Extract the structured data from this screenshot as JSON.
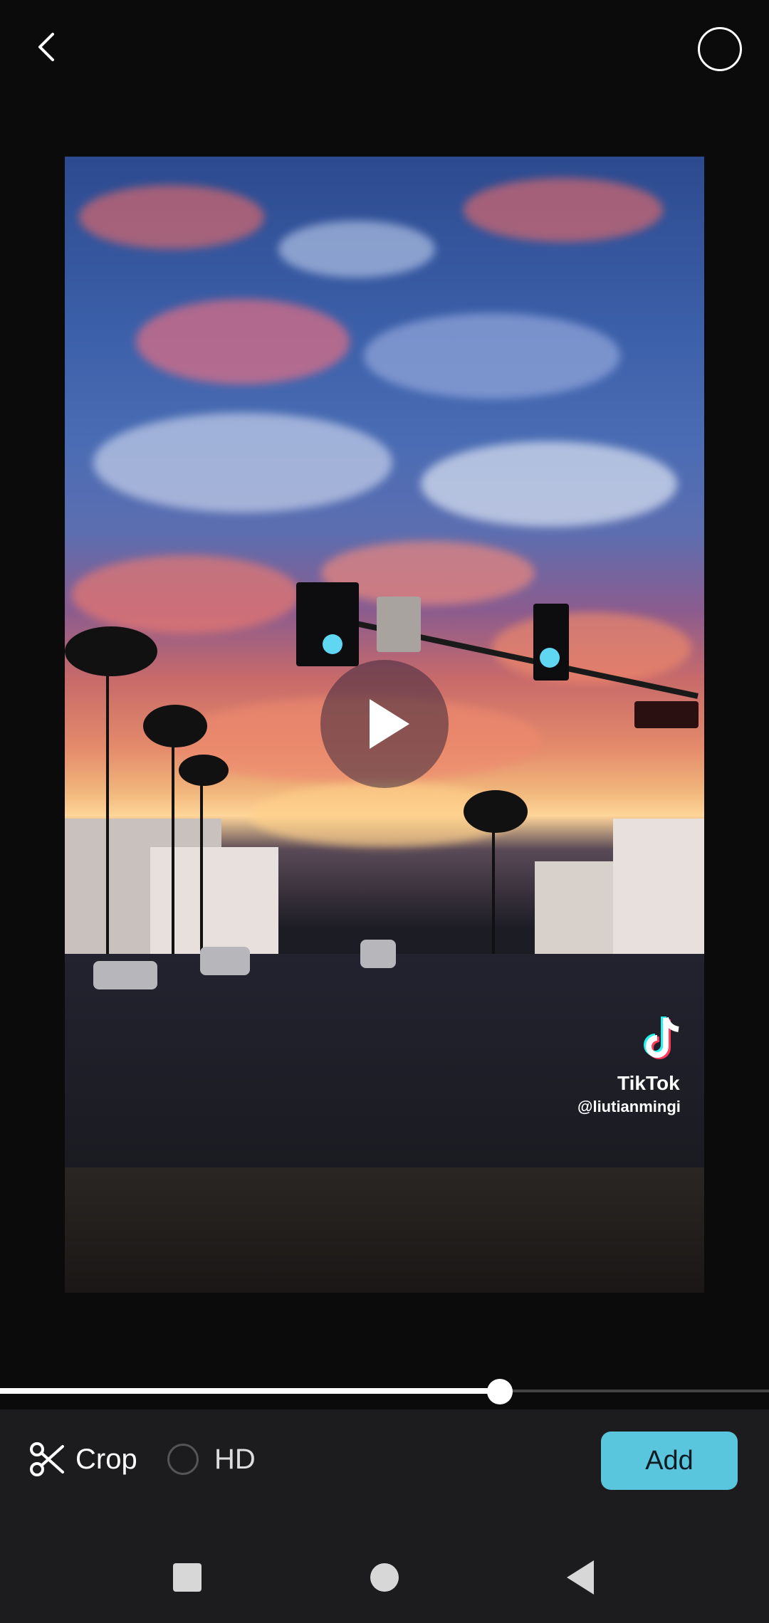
{
  "toolbar": {
    "back_icon": "chevron-left-icon",
    "select_icon": "circle-outline-icon"
  },
  "video": {
    "play_icon": "play-icon",
    "watermark": {
      "brand": "TikTok",
      "username": "@liutianmingi",
      "brand_icon": "tiktok-icon"
    }
  },
  "progress": {
    "value": 0.65
  },
  "actions": {
    "crop_label": "Crop",
    "hd_label": "HD",
    "hd_checked": false,
    "add_label": "Add"
  },
  "colors": {
    "accent": "#59c6dd",
    "background": "#0b0b0c",
    "panel": "#1c1c1e"
  },
  "navbar": {
    "recents_icon": "square-icon",
    "home_icon": "circle-icon",
    "back_icon": "triangle-back-icon"
  }
}
